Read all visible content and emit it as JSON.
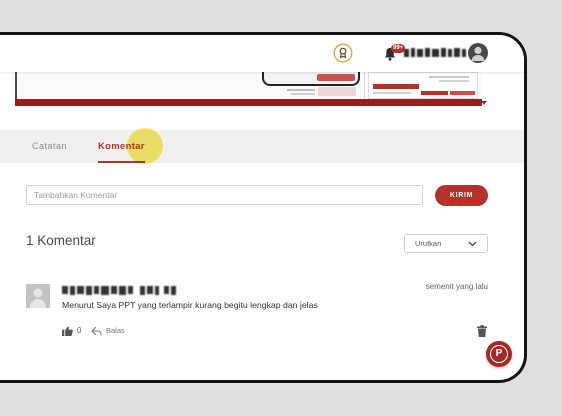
{
  "header": {
    "notification_count": "99+",
    "icons": {
      "award": "award-badge-icon",
      "notifications": "bell-icon",
      "profile": "user-avatar-icon"
    }
  },
  "tabs": [
    {
      "label": "Catatan",
      "active": false
    },
    {
      "label": "Komentar",
      "active": true
    }
  ],
  "comment_form": {
    "placeholder": "Tambahkan Komentar",
    "submit_label": "KIRIM"
  },
  "comments_section": {
    "count_label": "1 Komentar",
    "sort": {
      "selected": "Urutkan",
      "icon": "chevron-down-icon"
    }
  },
  "comments": [
    {
      "time": "semenit yang lalu",
      "text": "Menurut Saya PPT yang terlampir kurang begitu lengkap dan jelas",
      "likes": 0,
      "reply_label": "Balas",
      "icons": {
        "avatar": "user-placeholder-icon",
        "like": "thumbs-up-icon",
        "reply": "reply-icon",
        "delete": "trash-icon"
      }
    }
  ],
  "floating_button": {
    "label": "P"
  },
  "colors": {
    "accent": "#b3332b",
    "accent_dark": "#a02a25",
    "frame": "#141414",
    "tab_bar": "#f1f0ee",
    "highlight": "#f6e64a",
    "award": "#d9a23c"
  }
}
